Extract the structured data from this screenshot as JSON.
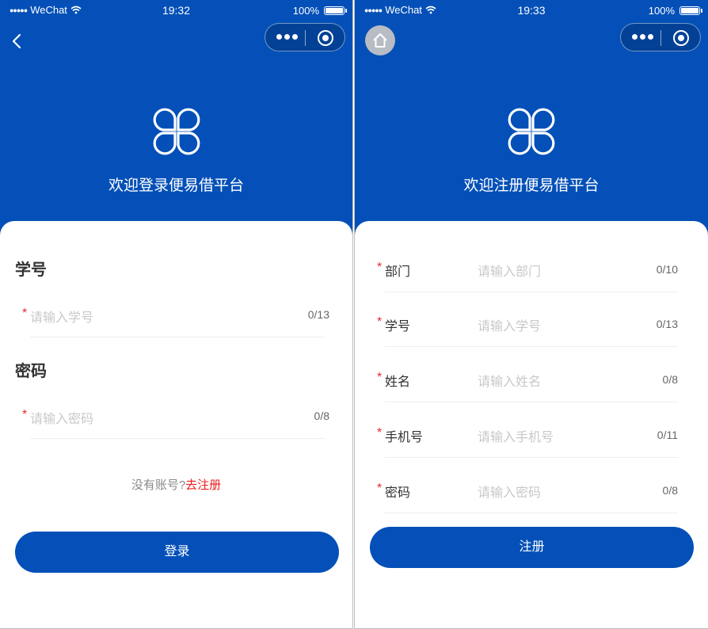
{
  "login_screen": {
    "status_bar": {
      "carrier": "WeChat",
      "time": "19:32",
      "battery": "100%"
    },
    "welcome_text": "欢迎登录便易借平台",
    "student_id_title": "学号",
    "student_id_placeholder": "请输入学号",
    "student_id_count": "0/13",
    "password_title": "密码",
    "password_placeholder": "请输入密码",
    "password_count": "0/8",
    "register_hint": "没有账号?",
    "register_link": "去注册",
    "login_button": "登录"
  },
  "register_screen": {
    "status_bar": {
      "carrier": "WeChat",
      "time": "19:33",
      "battery": "100%"
    },
    "welcome_text": "欢迎注册便易借平台",
    "fields": [
      {
        "label": "部门",
        "placeholder": "请输入部门",
        "count": "0/10"
      },
      {
        "label": "学号",
        "placeholder": "请输入学号",
        "count": "0/13"
      },
      {
        "label": "姓名",
        "placeholder": "请输入姓名",
        "count": "0/8"
      },
      {
        "label": "手机号",
        "placeholder": "请输入手机号",
        "count": "0/11"
      },
      {
        "label": "密码",
        "placeholder": "请输入密码",
        "count": "0/8"
      }
    ],
    "register_button": "注册"
  },
  "required_mark": "*",
  "colors": {
    "brand_blue": "#0450b8",
    "required_red": "#e02e2e",
    "link_red": "#e81d1d"
  },
  "icons": [
    "wifi-icon",
    "battery-icon",
    "back-arrow-icon",
    "home-icon",
    "more-icon",
    "miniprogram-close-icon",
    "clover-logo-icon"
  ]
}
